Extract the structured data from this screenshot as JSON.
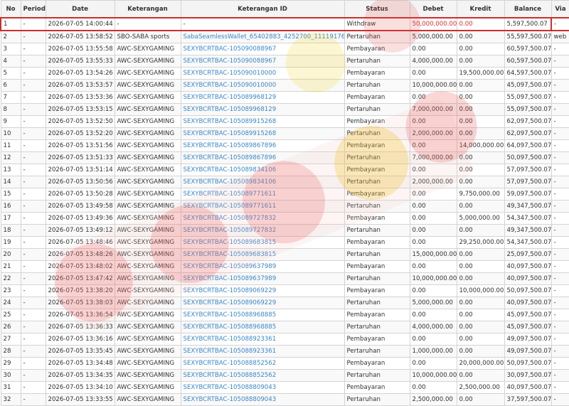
{
  "table": {
    "headers": [
      "No",
      "Periode",
      "Date",
      "Keterangan",
      "Keterangan ID",
      "Status",
      "Debet",
      "Kredit",
      "Balance",
      "Via"
    ],
    "rows": [
      [
        "1",
        "-",
        "2026-07-05 14:00:44",
        "-",
        "-",
        "Withdraw",
        "50,000,000.00",
        "0.00",
        "5,597,500.07",
        "-"
      ],
      [
        "2",
        "-",
        "2026-07-05 13:58:52",
        "SBO-SABA sports",
        "SabaSeamlessWallet_65402883_4252700_111191760",
        "Pertaruhan",
        "5,000,000.00",
        "0.00",
        "55,597,500.07",
        "web"
      ],
      [
        "3",
        "-",
        "2026-07-05 13:55:58",
        "AWC-SEXYGAMING",
        "SEXYBCRTBAC-105090088967",
        "Pembayaran",
        "0.00",
        "0.00",
        "60,597,500.07",
        "-"
      ],
      [
        "4",
        "-",
        "2026-07-05 13:55:33",
        "AWC-SEXYGAMING",
        "SEXYBCRTBAC-105090088967",
        "Pertaruhan",
        "4,000,000.00",
        "0.00",
        "60,597,500.07",
        "-"
      ],
      [
        "5",
        "-",
        "2026-07-05 13:54:26",
        "AWC-SEXYGAMING",
        "SEXYBCRTBAC-105090010000",
        "Pembayaran",
        "0.00",
        "19,500,000.00",
        "64,597,500.07",
        "-"
      ],
      [
        "6",
        "-",
        "2026-07-05 13:53:57",
        "AWC-SEXYGAMING",
        "SEXYBCRTBAC-105090010000",
        "Pertaruhan",
        "10,000,000.00",
        "0.00",
        "45,097,500.07",
        "-"
      ],
      [
        "7",
        "-",
        "2026-07-05 13:53:36",
        "AWC-SEXYGAMING",
        "SEXYBCRTBAC-105089968129",
        "Pembayaran",
        "0.00",
        "0.00",
        "55,097,500.07",
        "-"
      ],
      [
        "8",
        "-",
        "2026-07-05 13:53:15",
        "AWC-SEXYGAMING",
        "SEXYBCRTBAC-105089968129",
        "Pertaruhan",
        "7,000,000.00",
        "0.00",
        "55,097,500.07",
        "-"
      ],
      [
        "9",
        "-",
        "2026-07-05 13:52:50",
        "AWC-SEXYGAMING",
        "SEXYBCRTBAC-105089915268",
        "Pembayaran",
        "0.00",
        "0.00",
        "62,097,500.07",
        "-"
      ],
      [
        "10",
        "-",
        "2026-07-05 13:52:20",
        "AWC-SEXYGAMING",
        "SEXYBCRTBAC-105089915268",
        "Pertaruhan",
        "2,000,000.00",
        "0.00",
        "62,097,500.07",
        "-"
      ],
      [
        "11",
        "-",
        "2026-07-05 13:51:56",
        "AWC-SEXYGAMING",
        "SEXYBCRTBAC-105089867896",
        "Pembayaran",
        "0.00",
        "14,000,000.00",
        "64,097,500.07",
        "-"
      ],
      [
        "12",
        "-",
        "2026-07-05 13:51:33",
        "AWC-SEXYGAMING",
        "SEXYBCRTBAC-105089867896",
        "Pertaruhan",
        "7,000,000.00",
        "0.00",
        "50,097,500.07",
        "-"
      ],
      [
        "13",
        "-",
        "2026-07-05 13:51:14",
        "AWC-SEXYGAMING",
        "SEXYBCRTBAC-105089834106",
        "Pembayaran",
        "0.00",
        "0.00",
        "57,097,500.07",
        "-"
      ],
      [
        "14",
        "-",
        "2026-07-05 13:50:56",
        "AWC-SEXYGAMING",
        "SEXYBCRTBAC-105089834106",
        "Pertaruhan",
        "2,000,000.00",
        "0.00",
        "57,097,500.07",
        "-"
      ],
      [
        "15",
        "-",
        "2026-07-05 13:50:28",
        "AWC-SEXYGAMING",
        "SEXYBCRTBAC-105089771611",
        "Pembayaran",
        "0.00",
        "9,750,000.00",
        "59,097,500.07",
        "-"
      ],
      [
        "16",
        "-",
        "2026-07-05 13:49:58",
        "AWC-SEXYGAMING",
        "SEXYBCRTBAC-105089771611",
        "Pertaruhan",
        "0.00",
        "0.00",
        "49,347,500.07",
        "-"
      ],
      [
        "17",
        "-",
        "2026-07-05 13:49:36",
        "AWC-SEXYGAMING",
        "SEXYBCRTBAC-105089727832",
        "Pembayaran",
        "0.00",
        "5,000,000.00",
        "54,347,500.07",
        "-"
      ],
      [
        "18",
        "-",
        "2026-07-05 13:49:12",
        "AWC-SEXYGAMING",
        "SEXYBCRTBAC-105089727832",
        "Pertaruhan",
        "0.00",
        "0.00",
        "49,347,500.07",
        "-"
      ],
      [
        "19",
        "-",
        "2026-07-05 13:48:46",
        "AWC-SEXYGAMING",
        "SEXYBCRTBAC-105089683815",
        "Pembayaran",
        "0.00",
        "29,250,000.00",
        "54,347,500.07",
        "-"
      ],
      [
        "20",
        "-",
        "2026-07-05 13:48:26",
        "AWC-SEXYGAMING",
        "SEXYBCRTBAC-105089683815",
        "Pertaruhan",
        "15,000,000.00",
        "0.00",
        "25,097,500.07",
        "-"
      ],
      [
        "21",
        "-",
        "2026-07-05 13:48:02",
        "AWC-SEXYGAMING",
        "SEXYBCRTBAC-105089637989",
        "Pembayaran",
        "0.00",
        "0.00",
        "40,097,500.07",
        "-"
      ],
      [
        "22",
        "-",
        "2026-07-05 13:47:42",
        "AWC-SEXYGAMING",
        "SEXYBCRTBAC-105089637989",
        "Pertaruhan",
        "10,000,000.00",
        "0.00",
        "40,097,500.07",
        "-"
      ],
      [
        "23",
        "-",
        "2026-07-05 13:38:20",
        "AWC-SEXYGAMING",
        "SEXYBCRTBAC-105089069229",
        "Pembayaran",
        "0.00",
        "10,000,000.00",
        "50,097,500.07",
        "-"
      ],
      [
        "24",
        "-",
        "2026-07-05 13:38:03",
        "AWC-SEXYGAMING",
        "SEXYBCRTBAC-105089069229",
        "Pertaruhan",
        "5,000,000.00",
        "0.00",
        "40,097,500.07",
        "-"
      ],
      [
        "25",
        "-",
        "2026-07-05 13:36:54",
        "AWC-SEXYGAMING",
        "SEXYBCRTBAC-105088968885",
        "Pembayaran",
        "0.00",
        "0.00",
        "45,097,500.07",
        "-"
      ],
      [
        "26",
        "-",
        "2026-07-05 13:36:33",
        "AWC-SEXYGAMING",
        "SEXYBCRTBAC-105088968885",
        "Pertaruhan",
        "4,000,000.00",
        "0.00",
        "45,097,500.07",
        "-"
      ],
      [
        "27",
        "-",
        "2026-07-05 13:36:16",
        "AWC-SEXYGAMING",
        "SEXYBCRTBAC-105088923361",
        "Pembayaran",
        "0.00",
        "0.00",
        "49,097,500.07",
        "-"
      ],
      [
        "28",
        "-",
        "2026-07-05 13:35:45",
        "AWC-SEXYGAMING",
        "SEXYBCRTBAC-105088923361",
        "Pertaruhan",
        "1,000,000.00",
        "0.00",
        "49,097,500.07",
        "-"
      ],
      [
        "29",
        "-",
        "2026-07-05 13:34:48",
        "AWC-SEXYGAMING",
        "SEXYBCRTBAC-105088852562",
        "Pembayaran",
        "0.00",
        "20,000,000.00",
        "50,097,500.07",
        "-"
      ],
      [
        "30",
        "-",
        "2026-07-05 13:34:35",
        "AWC-SEXYGAMING",
        "SEXYBCRTBAC-105088852562",
        "Pertaruhan",
        "10,000,000.00",
        "0.00",
        "30,097,500.07",
        "-"
      ],
      [
        "31",
        "-",
        "2026-07-05 13:34:10",
        "AWC-SEXYGAMING",
        "SEXYBCRTBAC-105088809043",
        "Pembayaran",
        "0.00",
        "2,500,000.00",
        "40,097,500.07",
        "-"
      ],
      [
        "32",
        "-",
        "2026-07-05 13:33:55",
        "AWC-SEXYGAMING",
        "SEXYBCRTBAC-105088809043",
        "Pertaruhan",
        "2,500,000.00",
        "0.00",
        "37,597,500.07",
        "-"
      ]
    ]
  },
  "colors": {
    "link": "#3a87c8",
    "highlight_border": "#c9302c",
    "highlight_text": "#d9302c"
  },
  "watermark": {
    "icon": "watermark-logo-icon"
  }
}
